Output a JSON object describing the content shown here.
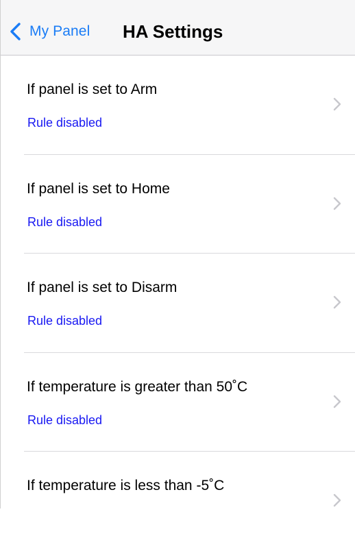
{
  "navbar": {
    "back_label": "My Panel",
    "title": "HA Settings",
    "back_icon": "chevron-left-icon"
  },
  "rows": [
    {
      "title": "If panel is set to Arm",
      "status": "Rule disabled"
    },
    {
      "title": "If panel is set to Home",
      "status": "Rule disabled"
    },
    {
      "title": "If panel is set to Disarm",
      "status": "Rule disabled"
    },
    {
      "title": "If temperature is greater than 50˚C",
      "status": "Rule disabled"
    },
    {
      "title": "If temperature is less than -5˚C",
      "status": ""
    }
  ],
  "colors": {
    "accent": "#1a7cf6",
    "status": "#1717f2",
    "navbar_bg": "#f6f6f7",
    "separator": "#d9d9dc",
    "chevron": "#c7c7cc"
  }
}
